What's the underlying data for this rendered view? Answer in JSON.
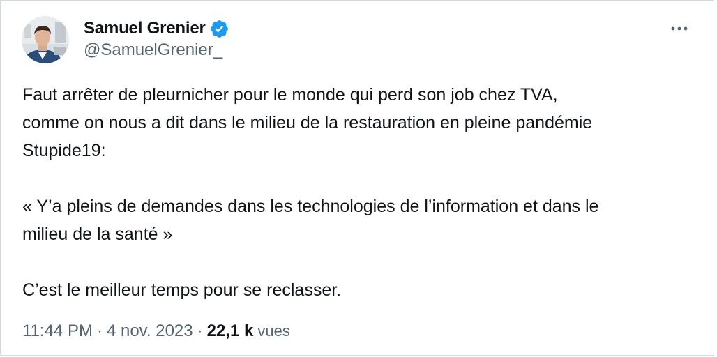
{
  "author": {
    "display_name": "Samuel Grenier",
    "handle": "@SamuelGrenier_",
    "verified": true,
    "avatar_icon": "person-avatar-icon",
    "verified_icon": "verified-badge-icon"
  },
  "menu": {
    "icon": "more-horizontal-icon"
  },
  "tweet": {
    "lines": [
      "Faut arrêter de pleurnicher pour le monde qui perd son job chez TVA,",
      "comme on nous a dit dans le milieu de la restauration en pleine pandémie",
      "Stupide19:",
      "« Y’a pleins de demandes dans les technologies de l’information et dans le",
      "milieu de la santé »",
      "C’est le meilleur temps pour se reclasser."
    ]
  },
  "meta": {
    "time": "11:44 PM",
    "separator": "·",
    "date": "4 nov. 2023",
    "views_count": "22,1 k",
    "views_label": "vues"
  },
  "colors": {
    "text": "#0f1419",
    "secondary": "#536471",
    "verified": "#1d9bf0",
    "border": "#cfd9de"
  }
}
